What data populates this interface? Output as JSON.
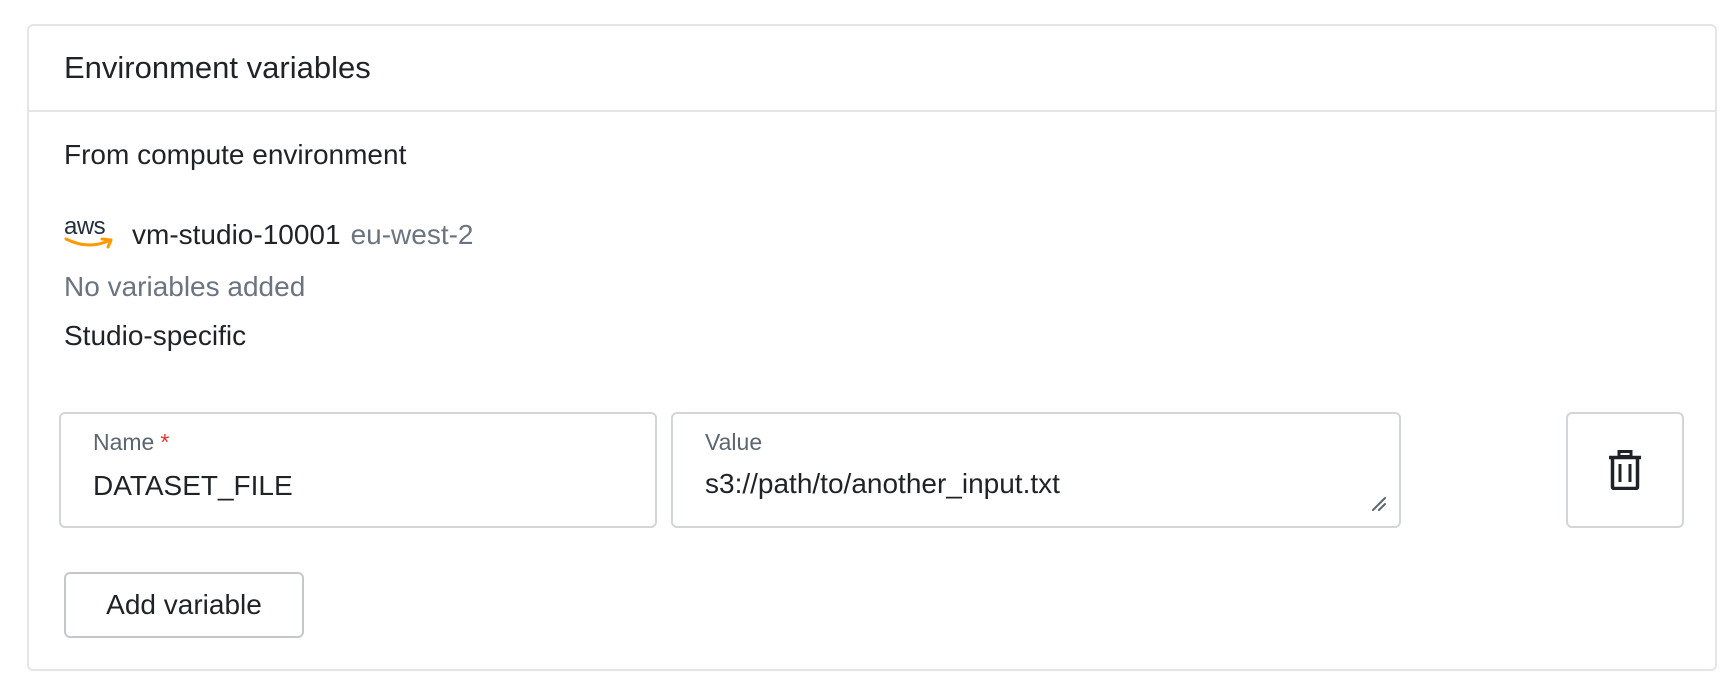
{
  "card": {
    "title": "Environment variables"
  },
  "compute": {
    "section_label": "From compute environment",
    "provider_logo_text": "aws",
    "provider_icon": "aws-logo-icon",
    "env_name": "vm-studio-10001",
    "region": "eu-west-2",
    "empty_message": "No variables added"
  },
  "studio": {
    "section_label": "Studio-specific",
    "variables": [
      {
        "name_label": "Name",
        "required_marker": "*",
        "name_value": "DATASET_FILE",
        "value_label": "Value",
        "value_value": "s3://path/to/another_input.txt",
        "delete_icon": "trash-icon"
      }
    ],
    "add_button_label": "Add variable"
  },
  "colors": {
    "border": "#e3e5e8",
    "muted_text": "#6b7480",
    "required": "#e0342f",
    "aws_orange": "#ff9900"
  }
}
